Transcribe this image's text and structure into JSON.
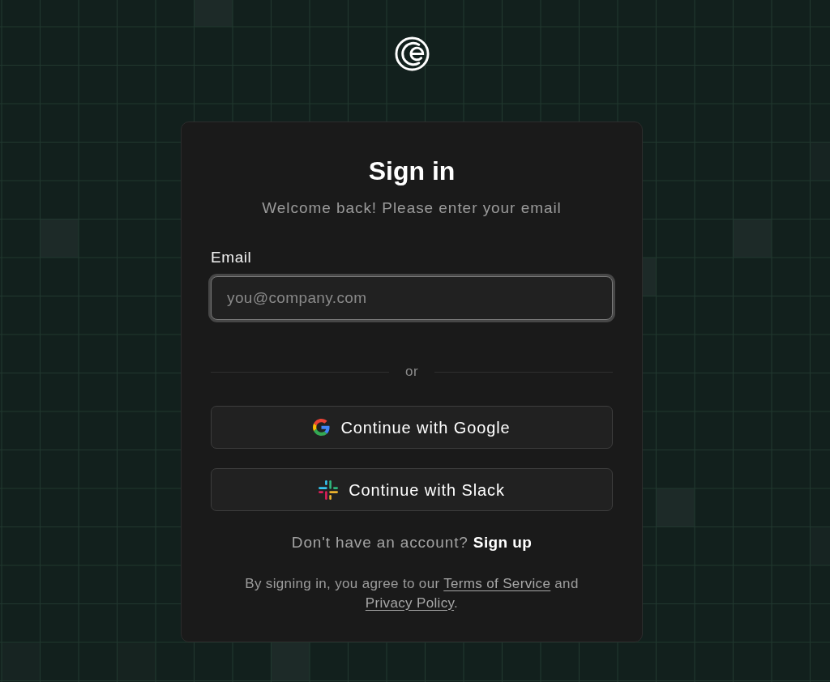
{
  "card": {
    "title": "Sign in",
    "subtitle": "Welcome back! Please enter your email"
  },
  "email_field": {
    "label": "Email",
    "placeholder": "you@company.com",
    "focused": true
  },
  "divider": {
    "label": "or"
  },
  "buttons": [
    {
      "kind": "google",
      "label": "Continue with Google"
    },
    {
      "kind": "slack",
      "label": "Continue with Slack"
    }
  ],
  "signup": {
    "text": "Don't have an account?",
    "link": "Sign up"
  },
  "legal": {
    "parts": [
      {
        "kind": "text",
        "text": "By signing in, you agree to our "
      },
      {
        "kind": "link",
        "text": "Terms of Service"
      },
      {
        "kind": "text",
        "text": " and "
      },
      {
        "kind": "link",
        "text": "Privacy Policy"
      },
      {
        "kind": "text",
        "text": "."
      }
    ]
  }
}
